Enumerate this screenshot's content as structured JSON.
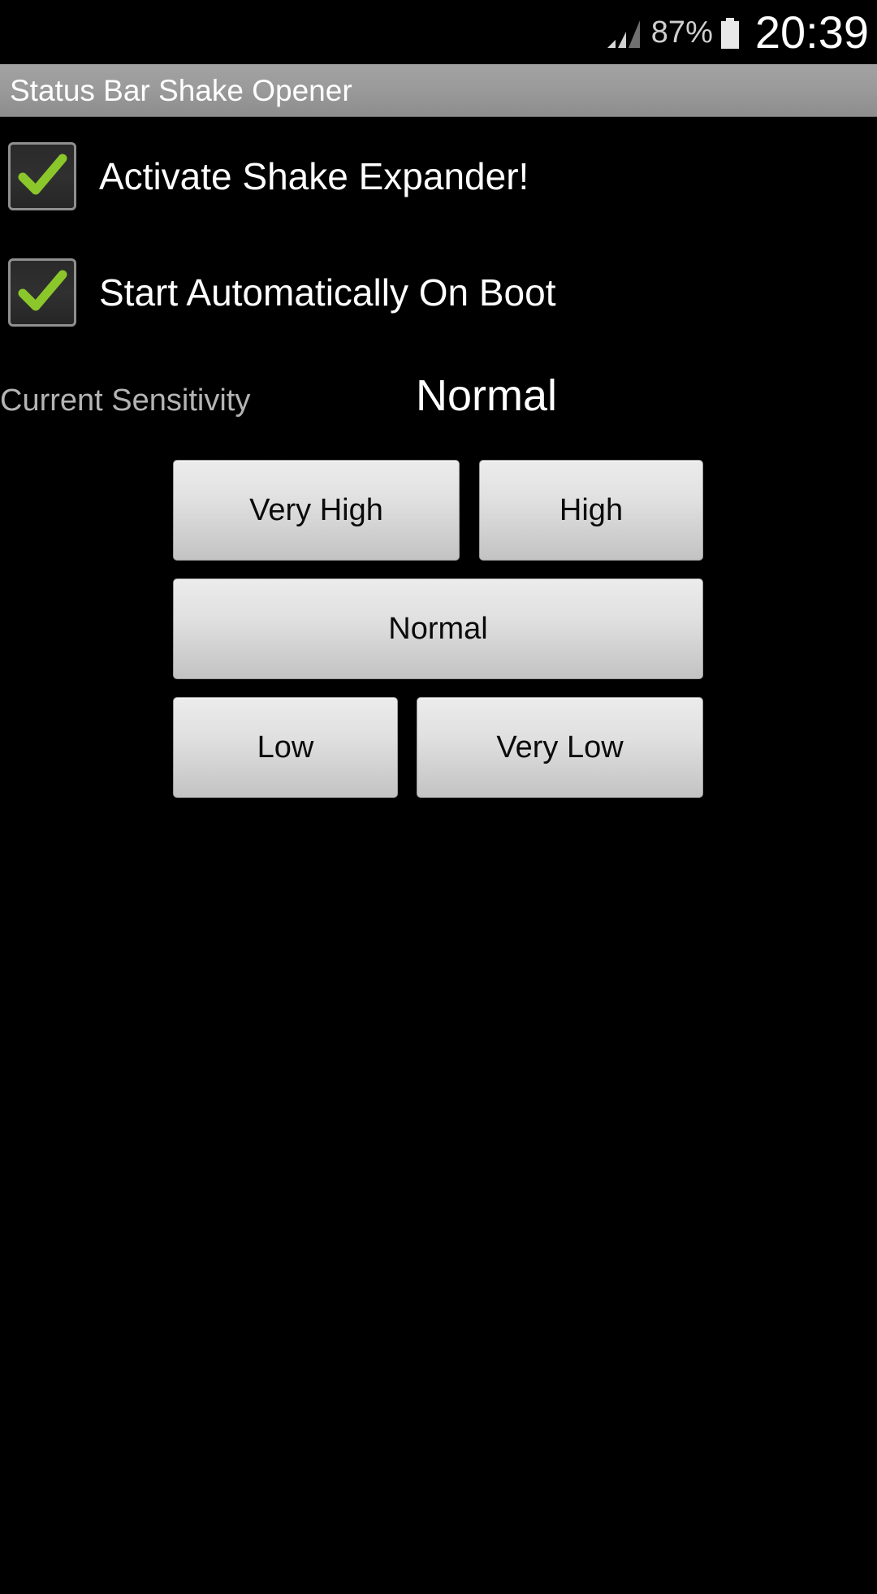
{
  "statusbar": {
    "signal_icon": "signal-bars-icon",
    "battery_percent": "87%",
    "battery_icon": "battery-full-icon",
    "clock": "20:39"
  },
  "titlebar": {
    "title": "Status Bar Shake Opener"
  },
  "options": [
    {
      "id": "activate-shake-expander",
      "label": "Activate Shake Expander!",
      "checked": true,
      "check_icon": "check-mark-icon"
    },
    {
      "id": "start-on-boot",
      "label": "Start Automatically On Boot",
      "checked": true,
      "check_icon": "check-mark-icon"
    }
  ],
  "sensitivity": {
    "label": "Current Sensitivity",
    "value": "Normal",
    "buttons": [
      {
        "id": "very-high",
        "label": "Very High"
      },
      {
        "id": "high",
        "label": "High"
      },
      {
        "id": "normal",
        "label": "Normal"
      },
      {
        "id": "low",
        "label": "Low"
      },
      {
        "id": "very-low",
        "label": "Very Low"
      }
    ]
  },
  "colors": {
    "background": "#000000",
    "titlebar": "#9b9b9b",
    "check_green": "#8bc72b",
    "button_face": "#e0e0e0",
    "label_gray": "#b4b4b4",
    "text_white": "#ffffff"
  }
}
